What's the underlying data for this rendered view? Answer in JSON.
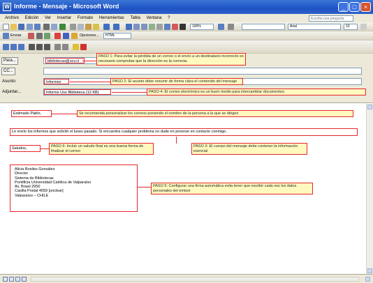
{
  "window": {
    "title": "Informe - Mensaje - Microsoft Word",
    "minimize": "_",
    "maximize": "□",
    "close": "×"
  },
  "menu": {
    "items": [
      "Archivo",
      "Edición",
      "Ver",
      "Insertar",
      "Formato",
      "Herramientas",
      "Tabla",
      "Ventana",
      "?"
    ],
    "help_placeholder": "Escriba una pregunta"
  },
  "toolbar": {
    "zoom": "100%",
    "font": "Arial",
    "font_size": "10",
    "send_label": "Enviar",
    "options_label": "Opciones...",
    "html_label": "HTML"
  },
  "header": {
    "to_label": "Para...",
    "to_value": "bibliotecas@ucv.cl",
    "cc_label": "CC...",
    "subject_label": "Asunto:",
    "subject_value": "Informes",
    "attach_label": "Adjuntar...",
    "attach_value": "Informe Uso Biblioteca (12 KB)"
  },
  "notes": {
    "paso1": "PASO 1: Para evitar la pérdida de un correo o el envío a un destinatario incorrecto es necesario comprobar que la dirección es la correcta.",
    "paso2": "PASO 2: El asunto debe resumir de forma clara el contenido del mensaje",
    "paso3": "PASO 3: El cuerpo del mensaje debe contener la información esencial",
    "paso4": "PASO 4: El correo electrónico es un buen medio para intercambiar documentos.",
    "paso5": "PASO 5: Configurar una firma automática evita tener que escribir cada vez los datos personales del emisor",
    "paso6": "PASO 6: Incluir un saludo final es una buena forma de finalizar el correo",
    "greeting_note": "Se recomienda personalizar los correos poniendo el nombre de la persona a la que se dirigen"
  },
  "body": {
    "greeting": "Estimado Pablo,",
    "message": "Le envío los informes que solicitó el lunes pasado. Si encuentra cualquier problema no dude en ponerse en contacto conmigo.",
    "closing": "Saludos,",
    "signature": [
      "Alicia Rosiles González",
      "Director",
      "Sistema de Bibliotecas",
      "Pontificia Universidad Católica de Valparaíso",
      "Av. Brasil 2950",
      "Casilla Postal 4059 [unclear]",
      "Valparaíso – CHILE"
    ]
  },
  "statusbar": {
    "views": [
      "normal",
      "web",
      "print",
      "outline"
    ]
  },
  "colors": {
    "title_bar": "#2b5fc9",
    "annotation_border": "#e8262c",
    "annotation_fill": "#fff9bf",
    "chrome": "#ece9d8"
  }
}
